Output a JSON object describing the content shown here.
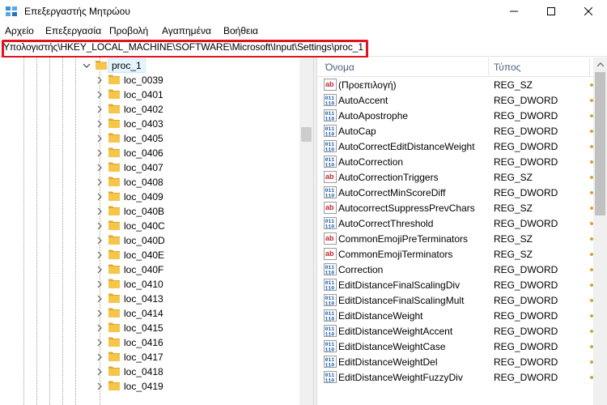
{
  "window": {
    "title": "Επεξεργαστής Μητρώου",
    "app_icon": "registry-icon",
    "controls": [
      "minimize-icon",
      "maximize-icon",
      "close-icon"
    ]
  },
  "menu": [
    "Αρχείο",
    "Επεξεργασία",
    "Προβολή",
    "Αγαπημένα",
    "Βοήθεια"
  ],
  "address": {
    "path": "Υπολογιστής\\HKEY_LOCAL_MACHINE\\SOFTWARE\\Microsoft\\Input\\Settings\\proc_1",
    "highlight_color": "#e0141e"
  },
  "tree": {
    "selected": "proc_1",
    "children": [
      "loc_0039",
      "loc_0401",
      "loc_0402",
      "loc_0403",
      "loc_0405",
      "loc_0406",
      "loc_0407",
      "loc_0408",
      "loc_0409",
      "loc_040B",
      "loc_040C",
      "loc_040D",
      "loc_040E",
      "loc_040F",
      "loc_0410",
      "loc_0413",
      "loc_0414",
      "loc_0415",
      "loc_0416",
      "loc_0417",
      "loc_0418",
      "loc_0419"
    ]
  },
  "values": {
    "headers": {
      "name": "Όνομα",
      "type": "Τύπος"
    },
    "rows": [
      {
        "name": "(Προεπιλογή)",
        "type": "REG_SZ",
        "icon": "string-value-icon"
      },
      {
        "name": "AutoAccent",
        "type": "REG_DWORD",
        "icon": "binary-value-icon"
      },
      {
        "name": "AutoApostrophe",
        "type": "REG_DWORD",
        "icon": "binary-value-icon"
      },
      {
        "name": "AutoCap",
        "type": "REG_DWORD",
        "icon": "binary-value-icon"
      },
      {
        "name": "AutoCorrectEditDistanceWeight",
        "type": "REG_DWORD",
        "icon": "binary-value-icon"
      },
      {
        "name": "AutoCorrection",
        "type": "REG_DWORD",
        "icon": "binary-value-icon"
      },
      {
        "name": "AutoCorrectionTriggers",
        "type": "REG_SZ",
        "icon": "string-value-icon"
      },
      {
        "name": "AutoCorrectMinScoreDiff",
        "type": "REG_DWORD",
        "icon": "binary-value-icon"
      },
      {
        "name": "AutocorrectSuppressPrevChars",
        "type": "REG_SZ",
        "icon": "string-value-icon"
      },
      {
        "name": "AutoCorrectThreshold",
        "type": "REG_DWORD",
        "icon": "binary-value-icon"
      },
      {
        "name": "CommonEmojiPreTerminators",
        "type": "REG_SZ",
        "icon": "string-value-icon"
      },
      {
        "name": "CommonEmojiTerminators",
        "type": "REG_SZ",
        "icon": "string-value-icon"
      },
      {
        "name": "Correction",
        "type": "REG_DWORD",
        "icon": "binary-value-icon"
      },
      {
        "name": "EditDistanceFinalScalingDiv",
        "type": "REG_DWORD",
        "icon": "binary-value-icon"
      },
      {
        "name": "EditDistanceFinalScalingMult",
        "type": "REG_DWORD",
        "icon": "binary-value-icon"
      },
      {
        "name": "EditDistanceWeight",
        "type": "REG_DWORD",
        "icon": "binary-value-icon"
      },
      {
        "name": "EditDistanceWeightAccent",
        "type": "REG_DWORD",
        "icon": "binary-value-icon"
      },
      {
        "name": "EditDistanceWeightCase",
        "type": "REG_DWORD",
        "icon": "binary-value-icon"
      },
      {
        "name": "EditDistanceWeightDel",
        "type": "REG_DWORD",
        "icon": "binary-value-icon"
      },
      {
        "name": "EditDistanceWeightFuzzyDiv",
        "type": "REG_DWORD",
        "icon": "binary-value-icon"
      }
    ]
  },
  "colors": {
    "folder": "#f5c64a",
    "folder_dark": "#e0a82e",
    "string_icon": "#c4262e",
    "binary_icon": "#1c5fb0",
    "selection": "#e5f3ff"
  }
}
